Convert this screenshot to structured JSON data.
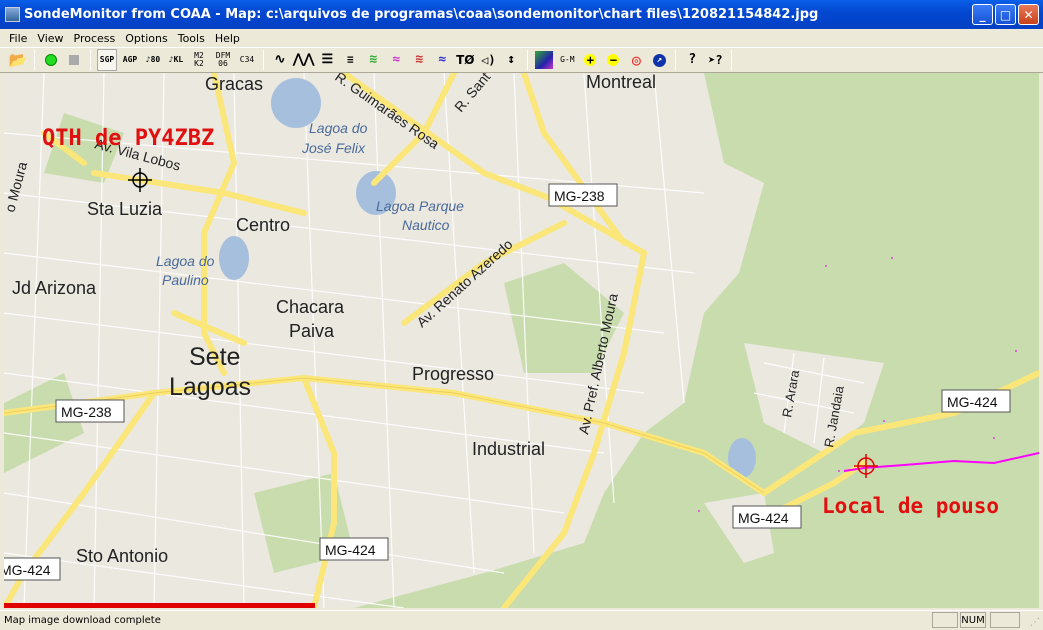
{
  "window": {
    "title": "SondeMonitor from COAA - Map: c:\\arquivos de programas\\coaa\\sondemonitor\\chart files\\120821154842.jpg",
    "minimize": "_",
    "maximize": "□",
    "close": "✕"
  },
  "menu": [
    "File",
    "View",
    "Process",
    "Options",
    "Tools",
    "Help"
  ],
  "toolbar": {
    "sgp": "SGP",
    "agp": "AGP",
    "r80": "80",
    "kl": "KL",
    "m2k2": "M2 K2",
    "dfm": "DFM 06",
    "c34": "C34",
    "t0": "TØ",
    "gm": "G-M",
    "help": "?",
    "whatsthis": "?"
  },
  "map": {
    "labels": {
      "gracas": "Gracas",
      "montreal": "Montreal",
      "sta_luzia": "Sta Luzia",
      "centro": "Centro",
      "jd_arizona": "Jd Arizona",
      "chacara": "Chacara",
      "paiva": "Paiva",
      "sete": "Sete",
      "lagoas": "Lagoas",
      "progresso": "Progresso",
      "industrial": "Industrial",
      "sto_antonio": "Sto Antonio"
    },
    "lakes": {
      "felix1": "Lagoa do",
      "felix2": "José Felix",
      "parque1": "Lagoa Parque",
      "parque2": "Nautico",
      "paulino1": "Lagoa do",
      "paulino2": "Paulino"
    },
    "streets": {
      "guimaraes": "R. Guimarães Rosa",
      "sant": "R. Sant",
      "vila_lobos": "Av. Vila Lobos",
      "moura_left": "o Moura",
      "renato": "Av. Renato Azeredo",
      "alberto": "Av. Pref. Alberto Moura",
      "arara": "R. Arara",
      "jandaia": "R. Jandaia"
    },
    "shields": {
      "mg238a": "MG-238",
      "mg238b": "MG-238",
      "mg424a": "MG-424",
      "mg424b": "MG-424",
      "mg424c": "MG-424",
      "mg424d": "MG-424"
    },
    "annotations": {
      "qth": "QTH de PY4ZBZ",
      "landing": "Local de pouso"
    },
    "colors": {
      "annotation": "#e01010",
      "track": "#ff00ff",
      "road": "#fbe67a"
    }
  },
  "progress": {
    "value": 0.3
  },
  "status": {
    "message": "Map image download complete",
    "num": "NUM"
  }
}
